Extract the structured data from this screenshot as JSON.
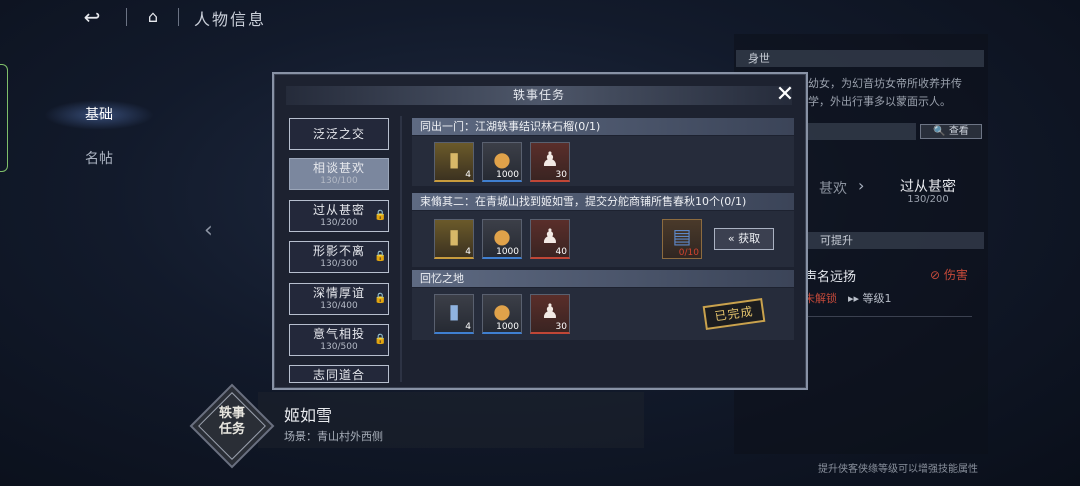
{
  "topbar": {
    "back_icon": "↩",
    "home_icon": "⌂",
    "title": "人物信息"
  },
  "nav": {
    "items": [
      {
        "label": "基础",
        "active": true
      },
      {
        "label": "名帖",
        "active": false
      }
    ]
  },
  "right_panel": {
    "section_identity": "身世",
    "identity_text_1": "幼女，为幻音坊女帝所收养并传",
    "identity_text_2": "学，外出行事多以蒙面示人。",
    "search_label": "查看",
    "rel_left_label": "甚欢",
    "rel_current_label": "过从甚密",
    "rel_current_progress": "130/200",
    "section_upgrade": "可提升",
    "skill_name": "声名远扬",
    "skill_damage": "伤害",
    "skill_locked": "未解锁",
    "skill_level": "等级1",
    "footer": "提升侠客侠缘等级可以增强技能属性"
  },
  "character": {
    "badge_line1": "轶事",
    "badge_line2": "任务",
    "name": "姬如雪",
    "scene": "场景：青山村外西侧"
  },
  "modal": {
    "title": "轶事任务",
    "close_icon": "✕",
    "stages": [
      {
        "label": "泛泛之交",
        "progress": "",
        "locked": false,
        "selected": false
      },
      {
        "label": "相谈甚欢",
        "progress": "130/100",
        "locked": false,
        "selected": true
      },
      {
        "label": "过从甚密",
        "progress": "130/200",
        "locked": true,
        "selected": false
      },
      {
        "label": "形影不离",
        "progress": "130/300",
        "locked": true,
        "selected": false
      },
      {
        "label": "深情厚谊",
        "progress": "130/400",
        "locked": true,
        "selected": false
      },
      {
        "label": "意气相投",
        "progress": "130/500",
        "locked": true,
        "selected": false
      },
      {
        "label": "志同道合",
        "progress": "",
        "locked": false,
        "selected": false
      }
    ],
    "tasks": [
      {
        "title": "同出一门：江湖轶事结识林石榴(0/1)",
        "rewards": [
          {
            "icon": "token-icon",
            "qty": "4"
          },
          {
            "icon": "coin-icon",
            "qty": "1000"
          },
          {
            "icon": "figure-icon",
            "qty": "30"
          }
        ]
      },
      {
        "title": "束翛其二：在青城山找到姬如雪，提交分舵商铺所售春秋10个(0/1)",
        "rewards": [
          {
            "icon": "token-icon",
            "qty": "4"
          },
          {
            "icon": "coin-icon",
            "qty": "1000"
          },
          {
            "icon": "figure-icon",
            "qty": "40"
          }
        ],
        "required_item": {
          "icon": "book-icon",
          "qty": "0/10"
        },
        "get_label": "获取"
      },
      {
        "title": "回忆之地",
        "rewards": [
          {
            "icon": "token-icon",
            "qty": "4"
          },
          {
            "icon": "coin-icon",
            "qty": "1000"
          },
          {
            "icon": "figure-icon",
            "qty": "30"
          }
        ],
        "completed_label": "已完成"
      }
    ]
  },
  "colors": {
    "accent_gold": "#c79b3d",
    "accent_blue": "#3f7fd0",
    "accent_red": "#c04636",
    "warning_red": "#c54a3a"
  }
}
